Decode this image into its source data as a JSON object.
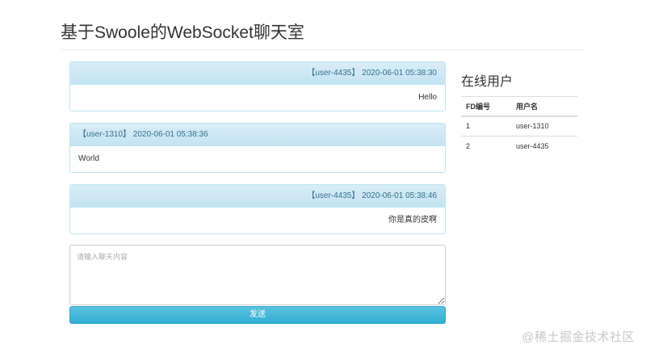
{
  "page": {
    "title": "基于Swoole的WebSocket聊天室"
  },
  "messages": [
    {
      "header": "【user-4435】 2020-06-01 05:38:30",
      "text": "Hello",
      "align": "right"
    },
    {
      "header": "【user-1310】 2020-06-01 05:38:36",
      "text": "World",
      "align": "left"
    },
    {
      "header": "【user-4435】 2020-06-01 05:38:46",
      "text": "你是真的皮啊",
      "align": "right"
    }
  ],
  "composer": {
    "placeholder": "请输入聊天内容",
    "send_label": "发送"
  },
  "online": {
    "heading": "在线用户",
    "columns": [
      "FD编号",
      "用户名"
    ],
    "rows": [
      {
        "fd": "1",
        "name": "user-1310"
      },
      {
        "fd": "2",
        "name": "user-4435"
      }
    ]
  },
  "watermark": "@稀土掘金技术社区",
  "colors": {
    "panel_border": "#bce8f1",
    "panel_header": "#d9edf7",
    "panel_header_text": "#31708f",
    "send_button": "#5bc0de"
  }
}
